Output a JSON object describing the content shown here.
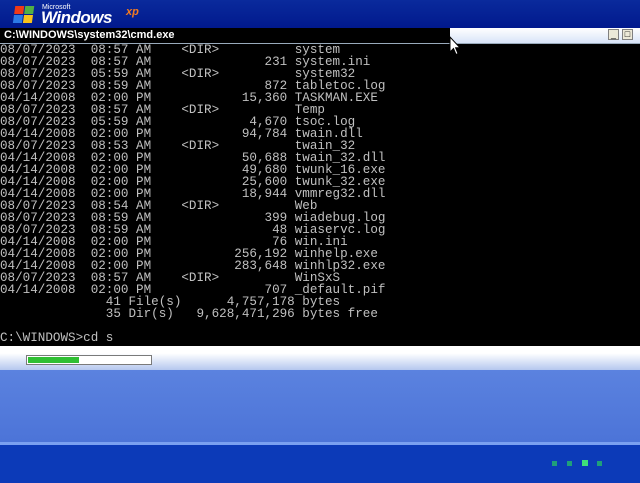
{
  "logo": {
    "ms": "Microsoft",
    "windows": "Windows",
    "xp": "xp"
  },
  "window": {
    "title": "C:\\WINDOWS\\system32\\cmd.exe",
    "minimize_glyph": "_",
    "maximize_glyph": "□"
  },
  "console": {
    "lines": [
      "08/07/2023  08:57 AM    <DIR>          system",
      "08/07/2023  08:57 AM               231 system.ini",
      "08/07/2023  05:59 AM    <DIR>          system32",
      "08/07/2023  08:59 AM               872 tabletoc.log",
      "04/14/2008  02:00 PM            15,360 TASKMAN.EXE",
      "08/07/2023  08:57 AM    <DIR>          Temp",
      "08/07/2023  05:59 AM             4,670 tsoc.log",
      "04/14/2008  02:00 PM            94,784 twain.dll",
      "08/07/2023  08:53 AM    <DIR>          twain_32",
      "04/14/2008  02:00 PM            50,688 twain_32.dll",
      "04/14/2008  02:00 PM            49,680 twunk_16.exe",
      "04/14/2008  02:00 PM            25,600 twunk_32.exe",
      "04/14/2008  02:00 PM            18,944 vmmreg32.dll",
      "08/07/2023  08:54 AM    <DIR>          Web",
      "08/07/2023  08:59 AM               399 wiadebug.log",
      "08/07/2023  08:59 AM                48 wiaservc.log",
      "04/14/2008  02:00 PM                76 win.ini",
      "04/14/2008  02:00 PM           256,192 winhelp.exe",
      "04/14/2008  02:00 PM           283,648 winhlp32.exe",
      "08/07/2023  08:57 AM    <DIR>          WinSxS",
      "04/14/2008  02:00 PM               707 _default.pif",
      "              41 File(s)      4,757,178 bytes",
      "              35 Dir(s)   9,628,471,296 bytes free",
      "",
      "C:\\WINDOWS>cd s"
    ]
  },
  "progress": {
    "fraction": 0.42,
    "color": "#2fbf33"
  },
  "pager": {
    "dot_count": 4,
    "active_index": 2
  },
  "colors": {
    "console_bg": "#000000",
    "console_fg": "#c0c0c0",
    "backdrop": "#5a7edc",
    "bar": "#0c3ab8"
  }
}
